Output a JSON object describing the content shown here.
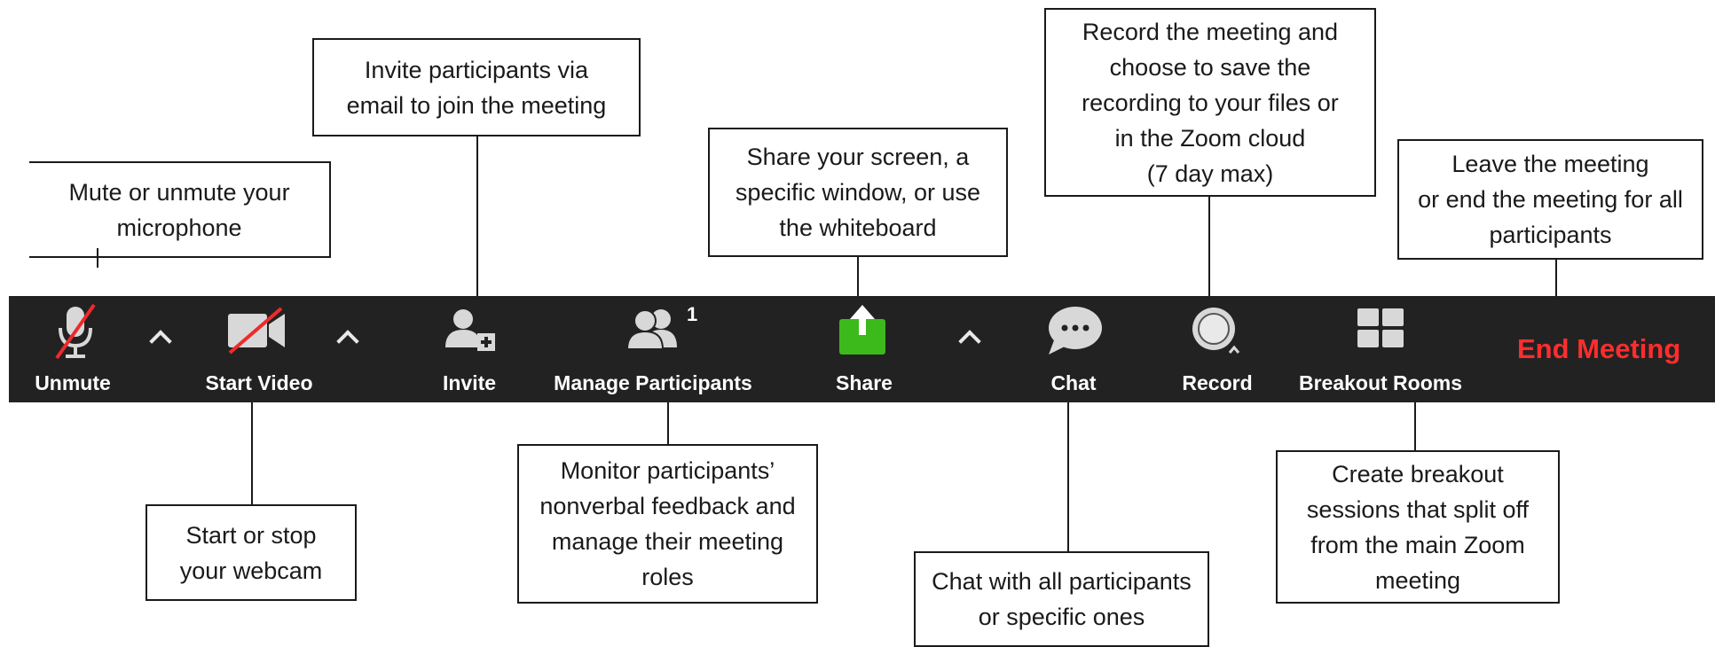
{
  "toolbar": {
    "unmute_label": "Unmute",
    "start_video_label": "Start Video",
    "invite_label": "Invite",
    "manage_participants_label": "Manage Participants",
    "participants_count": "1",
    "share_label": "Share",
    "chat_label": "Chat",
    "record_label": "Record",
    "breakout_rooms_label": "Breakout Rooms",
    "end_meeting_label": "End Meeting",
    "icons": {
      "unmute": "microphone-muted-icon",
      "start_video": "camera-off-icon",
      "invite": "add-person-icon",
      "manage_participants": "people-icon",
      "share": "share-arrow-icon",
      "chat": "speech-bubble-icon",
      "record": "record-circle-icon",
      "breakout_rooms": "grid-icon"
    },
    "colors": {
      "background": "#222222",
      "end_meeting": "#ff2d2d",
      "share_green": "#3cb91b",
      "strike_red": "#ee2a2a"
    }
  },
  "callouts": {
    "mute": "Mute or unmute your\nmicrophone",
    "webcam": "Start or stop\nyour webcam",
    "invite": "Invite participants via\nemail to join the meeting",
    "participants": "Monitor participants’\nnonverbal feedback and\nmanage their meeting\nroles",
    "share": "Share your screen, a\nspecific window, or use\nthe whiteboard",
    "chat": "Chat with all participants\nor specific ones",
    "record": "Record the meeting and\nchoose to save the\nrecording to your files or\nin the Zoom cloud\n(7 day max)",
    "breakout": "Create breakout\nsessions that split off\nfrom the main Zoom\nmeeting",
    "leave": "Leave the meeting\nor end the meeting for all\nparticipants"
  }
}
